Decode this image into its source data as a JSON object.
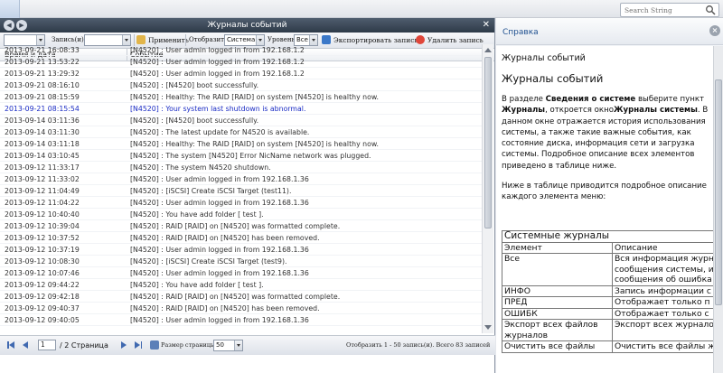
{
  "topbar": {
    "search_placeholder": "Search String"
  },
  "log_window": {
    "title": "Журналы событий",
    "toolbar": {
      "first_select_value": "",
      "records_label": "Запись(и)",
      "records_value": "",
      "apply_label": "Применить",
      "display_label": "Отобразить",
      "display_value": "Система",
      "level_label": "Уровень",
      "level_value": "Все",
      "export_label": "Экспортировать запись",
      "delete_label": "Удалить запись"
    },
    "columns": {
      "datetime": "Время и дата",
      "event": "Событие"
    },
    "rows": [
      {
        "time": "2013-09-21 16:08:33",
        "event": "[N4520] : User admin logged in from 192.168.1.2",
        "warn": false
      },
      {
        "time": "2013-09-21 13:53:22",
        "event": "[N4520] : User admin logged in from 192.168.1.2",
        "warn": false
      },
      {
        "time": "2013-09-21 13:29:32",
        "event": "[N4520] : User admin logged in from 192.168.1.2",
        "warn": false
      },
      {
        "time": "2013-09-21 08:16:10",
        "event": "[N4520] : [N4520] boot successfully.",
        "warn": false
      },
      {
        "time": "2013-09-21 08:15:59",
        "event": "[N4520] : Healthy: The RAID [RAID] on system [N4520] is healthy now.",
        "warn": false
      },
      {
        "time": "2013-09-21 08:15:54",
        "event": "[N4520] : Your system last shutdown is abnormal.",
        "warn": true
      },
      {
        "time": "2013-09-14 03:11:36",
        "event": "[N4520] : [N4520] boot successfully.",
        "warn": false
      },
      {
        "time": "2013-09-14 03:11:30",
        "event": "[N4520] : The latest update for N4520 is available.",
        "warn": false
      },
      {
        "time": "2013-09-14 03:11:18",
        "event": "[N4520] : Healthy: The RAID [RAID] on system [N4520] is healthy now.",
        "warn": false
      },
      {
        "time": "2013-09-14 03:10:45",
        "event": "[N4520] : The system [N4520] Error NicName network was plugged.",
        "warn": false
      },
      {
        "time": "2013-09-12 11:33:17",
        "event": "[N4520] : The system N4520 shutdown.",
        "warn": false
      },
      {
        "time": "2013-09-12 11:33:02",
        "event": "[N4520] : User admin logged in from 192.168.1.36",
        "warn": false
      },
      {
        "time": "2013-09-12 11:04:49",
        "event": "[N4520] : [iSCSI] Create iSCSI Target (test11).",
        "warn": false
      },
      {
        "time": "2013-09-12 11:04:22",
        "event": "[N4520] : User admin logged in from 192.168.1.36",
        "warn": false
      },
      {
        "time": "2013-09-12 10:40:40",
        "event": "[N4520] : You have add folder [ test ].",
        "warn": false
      },
      {
        "time": "2013-09-12 10:39:04",
        "event": "[N4520] : RAID [RAID] on [N4520] was formatted complete.",
        "warn": false
      },
      {
        "time": "2013-09-12 10:37:52",
        "event": "[N4520] : RAID [RAID] on [N4520] has been removed.",
        "warn": false
      },
      {
        "time": "2013-09-12 10:37:19",
        "event": "[N4520] : User admin logged in from 192.168.1.36",
        "warn": false
      },
      {
        "time": "2013-09-12 10:08:30",
        "event": "[N4520] : [iSCSI] Create iSCSI Target (test9).",
        "warn": false
      },
      {
        "time": "2013-09-12 10:07:46",
        "event": "[N4520] : User admin logged in from 192.168.1.36",
        "warn": false
      },
      {
        "time": "2013-09-12 09:44:22",
        "event": "[N4520] : You have add folder [ test ].",
        "warn": false
      },
      {
        "time": "2013-09-12 09:42:18",
        "event": "[N4520] : RAID [RAID] on [N4520] was formatted complete.",
        "warn": false
      },
      {
        "time": "2013-09-12 09:40:37",
        "event": "[N4520] : RAID [RAID] on [N4520] has been removed.",
        "warn": false
      },
      {
        "time": "2013-09-12 09:40:05",
        "event": "[N4520] : User admin logged in from 192.168.1.36",
        "warn": false
      }
    ],
    "pager": {
      "page_value": "1",
      "page_of": "/ 2 Страница",
      "page_size_label": "Размер страницы",
      "page_size_value": "50",
      "info": "Отобразить 1 - 50 запись(и). Всего 83 записей"
    }
  },
  "help": {
    "panel_title": "Справка",
    "heading1": "Журналы событий",
    "heading2": "Журналы событий",
    "para1": {
      "p1": "В разделе ",
      "b1": "Сведения о системе",
      "p2": " выберите пункт ",
      "b2": "Журналы",
      "p3": ", откроется окно",
      "b3": "Журналы системы",
      "p4": ". В данном окне отражается история использования системы, а также такие важные события, как состояние диска, информация сети и загрузка системы. Подробное описание всех элементов приведено в таблице ниже."
    },
    "para2": "Ниже в таблице приводится подробное описание каждого элемента меню:",
    "table": {
      "caption": "Системные журналы",
      "col_element": "Элемент",
      "col_desc": "Описание",
      "rows": [
        {
          "el": "Все",
          "desc": "Вся информация журн сообщения системы, и сообщения об ошибка"
        },
        {
          "el": "ИНФО",
          "desc": "Запись информации с"
        },
        {
          "el": "ПРЕД",
          "desc": "Отображает только п"
        },
        {
          "el": "ОШИБК",
          "desc": "Отображает только с"
        },
        {
          "el": "Экспорт всех файлов журналов",
          "desc": "Экспорт всех журнало"
        },
        {
          "el": "Очистить все файлы",
          "desc": "Очистить все файлы ж"
        }
      ]
    }
  },
  "colors": {
    "title_bar": "#2e3a48",
    "warn_text": "#1a2bc4",
    "help_title": "#1e4f8f"
  }
}
